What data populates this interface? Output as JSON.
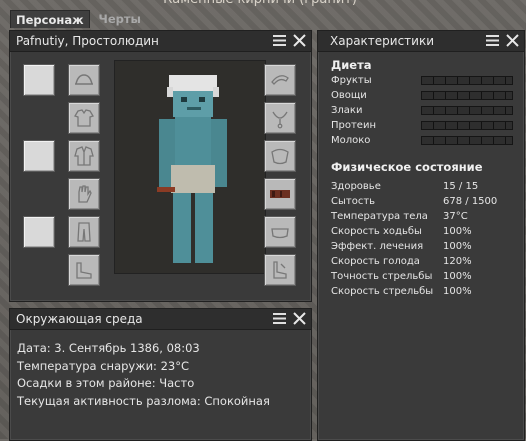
{
  "window_title": "Каменные кирпичи (гранит)",
  "tabs": [
    {
      "label": "Персонаж",
      "active": true
    },
    {
      "label": "Черты",
      "active": false
    }
  ],
  "character_panel": {
    "title": "Pafnutiy, Простолюдин"
  },
  "environment_panel": {
    "title": "Окружающая среда",
    "lines": [
      "Дата: 3. Сентябрь 1386, 08:03",
      "Температура снаружи: 23°C",
      "Осадки в этом районе: Часто",
      "Текущая активность разлома: Спокойная"
    ]
  },
  "attributes_panel": {
    "title": "Характеристики",
    "diet_title": "Диета",
    "diet": [
      {
        "label": "Фрукты",
        "fill": 0
      },
      {
        "label": "Овощи",
        "fill": 0
      },
      {
        "label": "Злаки",
        "fill": 0
      },
      {
        "label": "Протеин",
        "fill": 0
      },
      {
        "label": "Молоко",
        "fill": 0
      }
    ],
    "physical_title": "Физическое состояние",
    "stats": [
      {
        "label": "Здоровье",
        "value": "15 / 15"
      },
      {
        "label": "Сытость",
        "value": "678 / 1500"
      },
      {
        "label": "Температура тела",
        "value": "37°C"
      },
      {
        "label": "Скорость ходьбы",
        "value": "100%"
      },
      {
        "label": "Эффект. лечения",
        "value": "100%"
      },
      {
        "label": "Скорость голода",
        "value": "120%"
      },
      {
        "label": "Точность стрельбы",
        "value": "100%"
      },
      {
        "label": "Скорость стрельбы",
        "value": "100%"
      }
    ]
  },
  "slots": {
    "left_outer": [
      "empty",
      "empty",
      "empty"
    ],
    "left_inner": [
      "hat-slot-icon",
      "shirt-slot-icon",
      "jacket-slot-icon",
      "gloves-slot-icon",
      "trousers-slot-icon",
      "shoes-slot-icon"
    ],
    "right": [
      "head-accessory-slot-icon",
      "neck-slot-icon",
      "body-accessory-slot-icon",
      "belt-item",
      "waist-slot-icon",
      "feet-accessory-slot-icon"
    ]
  },
  "colors": {
    "panel_bg": "#3a3a3a",
    "header_bg": "#2e2e2e",
    "skin": "#4f8f99",
    "belt": "#6b2f20"
  }
}
